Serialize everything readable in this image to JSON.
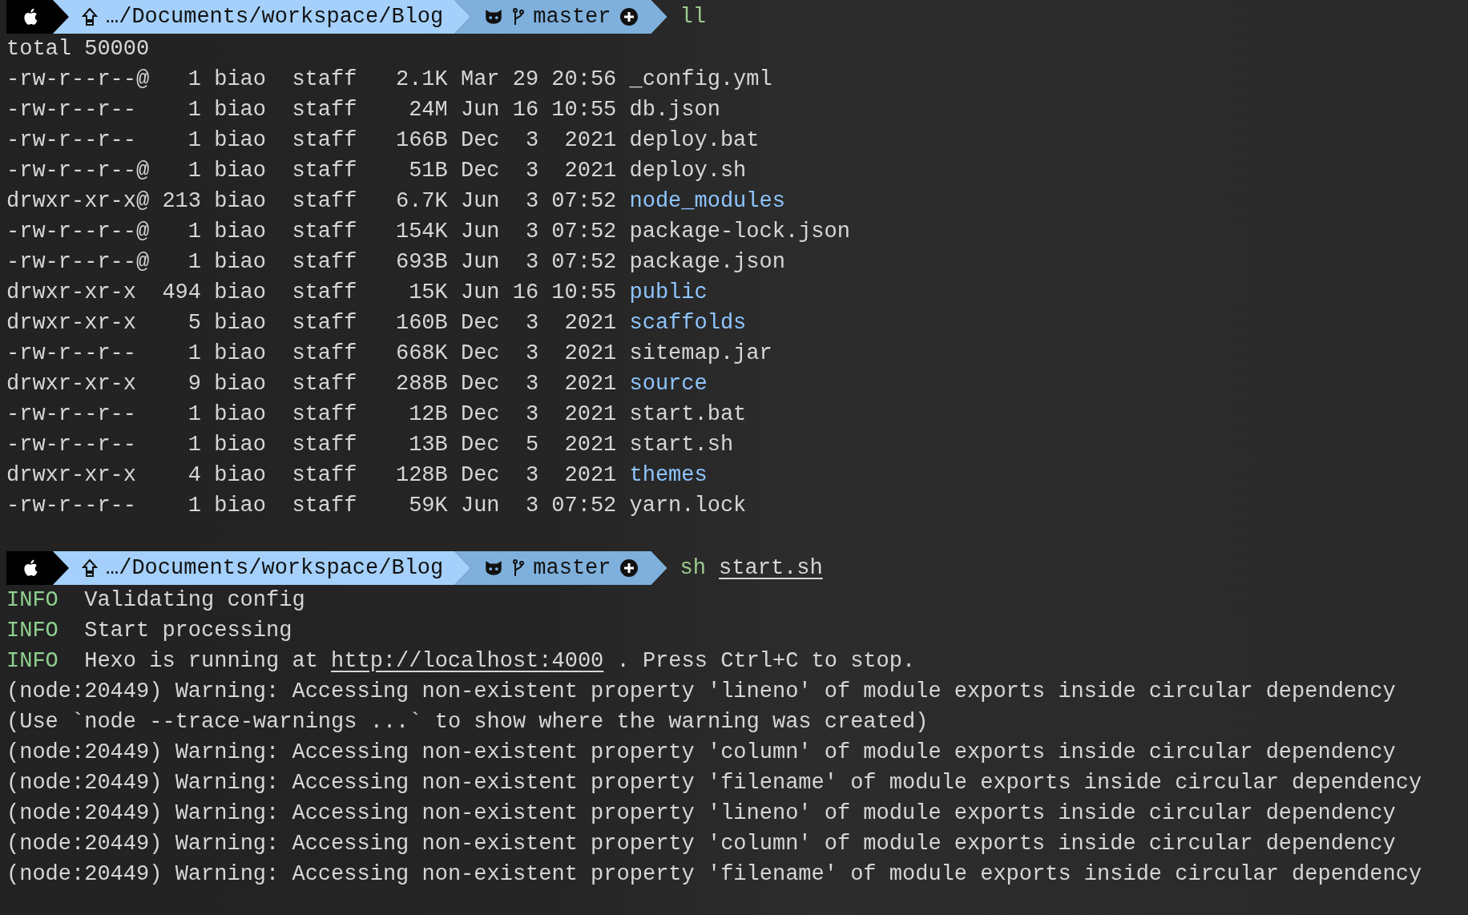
{
  "prompt_1": {
    "path": "…/Documents/workspace/Blog",
    "branch": "master",
    "program": "ll"
  },
  "listing": {
    "total": "total 50000",
    "rows": [
      {
        "perms": "-rw-r--r--@",
        "links": "1",
        "owner": "biao",
        "group": "staff",
        "size": "2.1K",
        "month": "Mar",
        "day": "29",
        "time": "20:56",
        "name": "_config.yml",
        "kind": "file"
      },
      {
        "perms": "-rw-r--r--",
        "links": "1",
        "owner": "biao",
        "group": "staff",
        "size": "24M",
        "month": "Jun",
        "day": "16",
        "time": "10:55",
        "name": "db.json",
        "kind": "file"
      },
      {
        "perms": "-rw-r--r--",
        "links": "1",
        "owner": "biao",
        "group": "staff",
        "size": "166B",
        "month": "Dec",
        "day": "3",
        "time": "2021",
        "name": "deploy.bat",
        "kind": "file"
      },
      {
        "perms": "-rw-r--r--@",
        "links": "1",
        "owner": "biao",
        "group": "staff",
        "size": "51B",
        "month": "Dec",
        "day": "3",
        "time": "2021",
        "name": "deploy.sh",
        "kind": "file"
      },
      {
        "perms": "drwxr-xr-x@",
        "links": "213",
        "owner": "biao",
        "group": "staff",
        "size": "6.7K",
        "month": "Jun",
        "day": "3",
        "time": "07:52",
        "name": "node_modules",
        "kind": "dir"
      },
      {
        "perms": "-rw-r--r--@",
        "links": "1",
        "owner": "biao",
        "group": "staff",
        "size": "154K",
        "month": "Jun",
        "day": "3",
        "time": "07:52",
        "name": "package-lock.json",
        "kind": "file"
      },
      {
        "perms": "-rw-r--r--@",
        "links": "1",
        "owner": "biao",
        "group": "staff",
        "size": "693B",
        "month": "Jun",
        "day": "3",
        "time": "07:52",
        "name": "package.json",
        "kind": "file"
      },
      {
        "perms": "drwxr-xr-x",
        "links": "494",
        "owner": "biao",
        "group": "staff",
        "size": "15K",
        "month": "Jun",
        "day": "16",
        "time": "10:55",
        "name": "public",
        "kind": "dir"
      },
      {
        "perms": "drwxr-xr-x",
        "links": "5",
        "owner": "biao",
        "group": "staff",
        "size": "160B",
        "month": "Dec",
        "day": "3",
        "time": "2021",
        "name": "scaffolds",
        "kind": "dir"
      },
      {
        "perms": "-rw-r--r--",
        "links": "1",
        "owner": "biao",
        "group": "staff",
        "size": "668K",
        "month": "Dec",
        "day": "3",
        "time": "2021",
        "name": "sitemap.jar",
        "kind": "file"
      },
      {
        "perms": "drwxr-xr-x",
        "links": "9",
        "owner": "biao",
        "group": "staff",
        "size": "288B",
        "month": "Dec",
        "day": "3",
        "time": "2021",
        "name": "source",
        "kind": "dir"
      },
      {
        "perms": "-rw-r--r--",
        "links": "1",
        "owner": "biao",
        "group": "staff",
        "size": "12B",
        "month": "Dec",
        "day": "3",
        "time": "2021",
        "name": "start.bat",
        "kind": "file"
      },
      {
        "perms": "-rw-r--r--",
        "links": "1",
        "owner": "biao",
        "group": "staff",
        "size": "13B",
        "month": "Dec",
        "day": "5",
        "time": "2021",
        "name": "start.sh",
        "kind": "file"
      },
      {
        "perms": "drwxr-xr-x",
        "links": "4",
        "owner": "biao",
        "group": "staff",
        "size": "128B",
        "month": "Dec",
        "day": "3",
        "time": "2021",
        "name": "themes",
        "kind": "dir"
      },
      {
        "perms": "-rw-r--r--",
        "links": "1",
        "owner": "biao",
        "group": "staff",
        "size": "59K",
        "month": "Jun",
        "day": "3",
        "time": "07:52",
        "name": "yarn.lock",
        "kind": "file"
      }
    ]
  },
  "prompt_2": {
    "path": "…/Documents/workspace/Blog",
    "branch": "master",
    "program": "sh",
    "args": [
      "start.sh"
    ]
  },
  "log": [
    {
      "kind": "info",
      "tag": "INFO",
      "text": "Validating config"
    },
    {
      "kind": "info",
      "tag": "INFO",
      "text": "Start processing"
    },
    {
      "kind": "info",
      "tag": "INFO",
      "text": "Hexo is running at",
      "link": "http://localhost:4000",
      "text_after": ". Press Ctrl+C to stop."
    },
    {
      "kind": "plain",
      "text": "(node:20449) Warning: Accessing non-existent property 'lineno' of module exports inside circular dependency"
    },
    {
      "kind": "plain",
      "text": "(Use `node --trace-warnings ...` to show where the warning was created)"
    },
    {
      "kind": "plain",
      "text": "(node:20449) Warning: Accessing non-existent property 'column' of module exports inside circular dependency"
    },
    {
      "kind": "plain",
      "text": "(node:20449) Warning: Accessing non-existent property 'filename' of module exports inside circular dependency"
    },
    {
      "kind": "plain",
      "text": "(node:20449) Warning: Accessing non-existent property 'lineno' of module exports inside circular dependency"
    },
    {
      "kind": "plain",
      "text": "(node:20449) Warning: Accessing non-existent property 'column' of module exports inside circular dependency"
    },
    {
      "kind": "plain",
      "text": "(node:20449) Warning: Accessing non-existent property 'filename' of module exports inside circular dependency"
    }
  ]
}
